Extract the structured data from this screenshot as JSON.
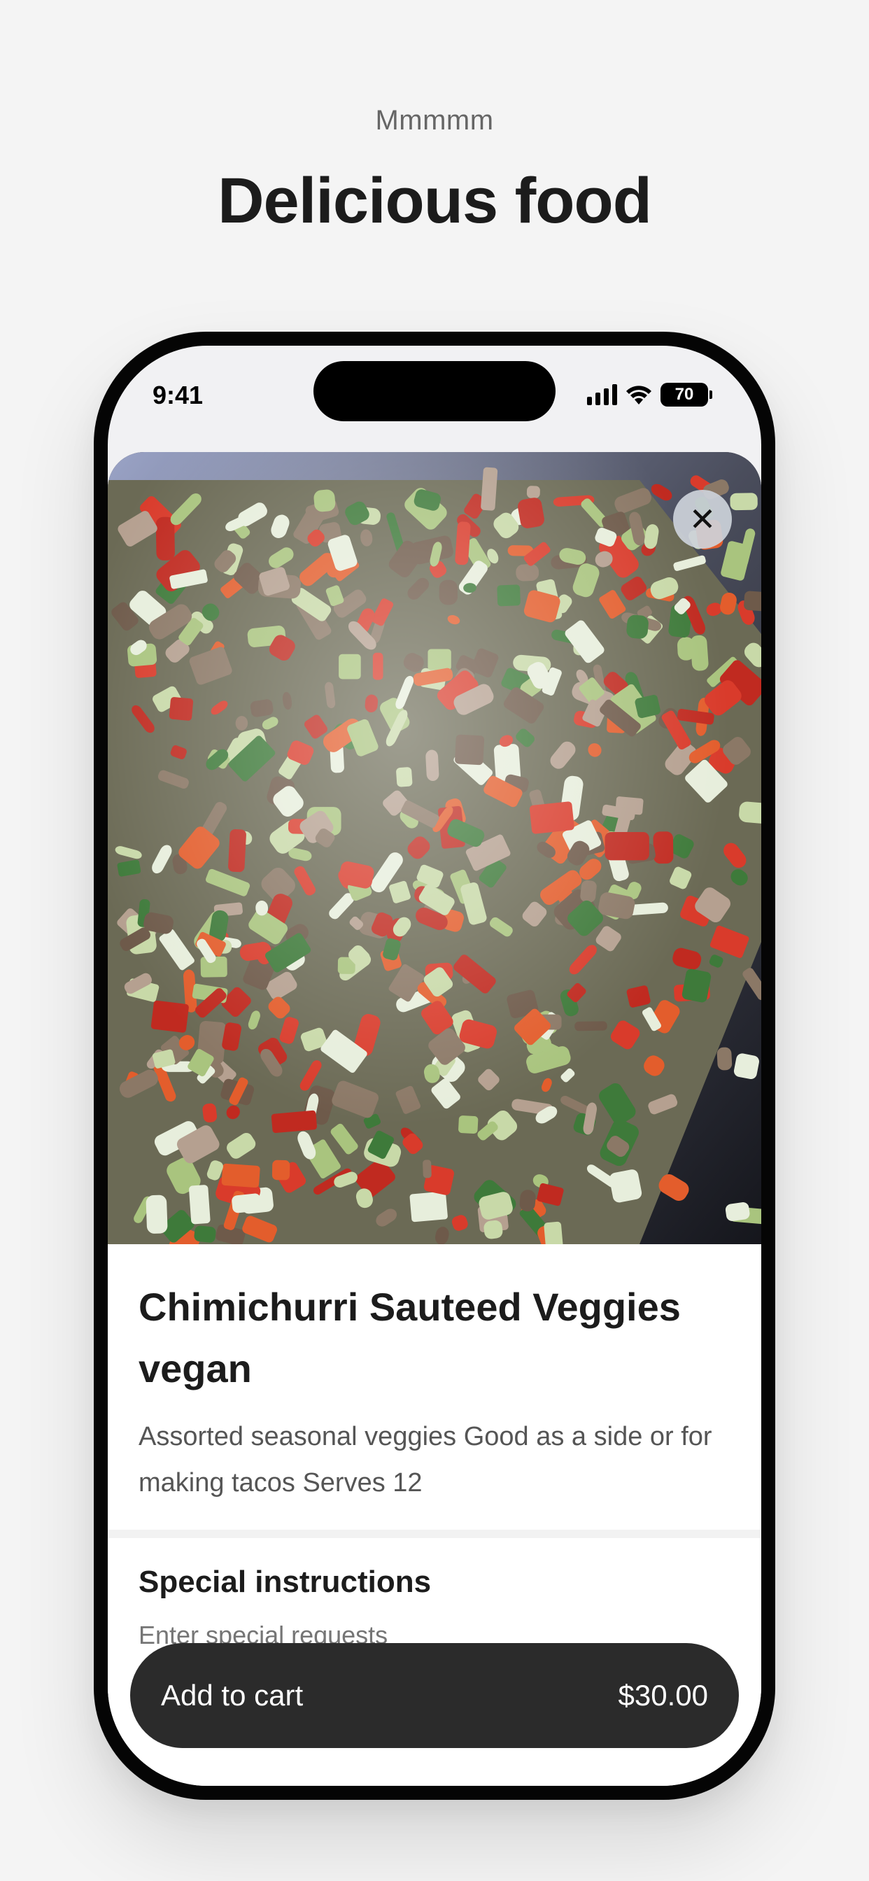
{
  "hero": {
    "eyebrow": "Mmmmm",
    "title": "Delicious food"
  },
  "status_bar": {
    "time": "9:41",
    "battery": "70"
  },
  "item": {
    "title": "Chimichurri Sauteed Veggies vegan",
    "description": "Assorted seasonal veggies Good as a side or for making tacos Serves 12"
  },
  "instructions": {
    "title": "Special instructions",
    "placeholder": "Enter special requests"
  },
  "cart": {
    "label": "Add to cart",
    "price": "$30.00"
  },
  "colors": {
    "background": "#f4f4f4",
    "cart_button": "#2b2b2b",
    "phone_frame": "#050505"
  },
  "icons": {
    "close": "close-icon",
    "signal": "cellular-signal-icon",
    "wifi": "wifi-icon",
    "battery": "battery-icon"
  }
}
